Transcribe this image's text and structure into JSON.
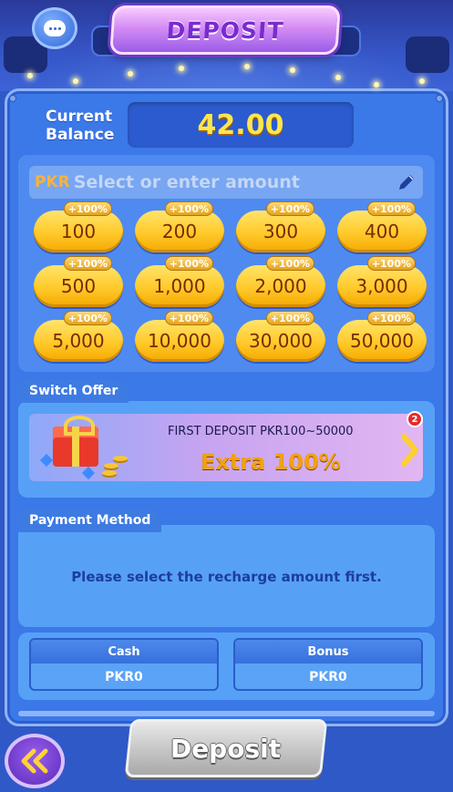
{
  "header": {
    "title": "DEPOSIT"
  },
  "balance": {
    "label_line1": "Current",
    "label_line2": "Balance",
    "value": "42.00"
  },
  "amount_input": {
    "currency": "PKR",
    "placeholder": "Select or enter amount"
  },
  "amounts": [
    {
      "value": "100",
      "bonus": "+100%"
    },
    {
      "value": "200",
      "bonus": "+100%"
    },
    {
      "value": "300",
      "bonus": "+100%"
    },
    {
      "value": "400",
      "bonus": "+100%"
    },
    {
      "value": "500",
      "bonus": "+100%"
    },
    {
      "value": "1,000",
      "bonus": "+100%"
    },
    {
      "value": "2,000",
      "bonus": "+100%"
    },
    {
      "value": "3,000",
      "bonus": "+100%"
    },
    {
      "value": "5,000",
      "bonus": "+100%"
    },
    {
      "value": "10,000",
      "bonus": "+100%"
    },
    {
      "value": "30,000",
      "bonus": "+100%"
    },
    {
      "value": "50,000",
      "bonus": "+100%"
    }
  ],
  "switch_offer": {
    "tab_label": "Switch Offer",
    "offer_line1": "FIRST DEPOSIT  PKR100~50000",
    "offer_line2": "Extra 100%",
    "badge_count": "2"
  },
  "payment_method": {
    "tab_label": "Payment Method",
    "message": "Please select the recharge amount first."
  },
  "wallet": {
    "cash_label": "Cash",
    "cash_value": "PKR0",
    "bonus_label": "Bonus",
    "bonus_value": "PKR0"
  },
  "footer": {
    "deposit_label": "Deposit"
  },
  "icons": {
    "support": "chat-support-icon",
    "edit": "pencil-icon",
    "next": "chevron-right-icon",
    "back": "double-chevron-left-icon"
  },
  "colors": {
    "accent_gold": "#ffc92a",
    "balance_text": "#ffe64a",
    "panel": "#3b78e8"
  }
}
